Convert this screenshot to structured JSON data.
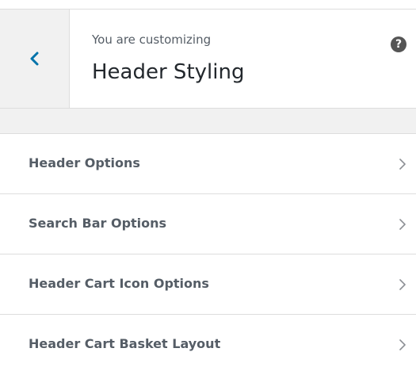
{
  "header": {
    "subtitle": "You are customizing",
    "title": "Header Styling",
    "back_icon": "chevron-left-icon",
    "help_icon": "question-circle-icon",
    "help_glyph": "?"
  },
  "sections": [
    {
      "label": "Header Options",
      "icon": "chevron-right-icon"
    },
    {
      "label": "Search Bar Options",
      "icon": "chevron-right-icon"
    },
    {
      "label": "Header Cart Icon Options",
      "icon": "chevron-right-icon"
    },
    {
      "label": "Header Cart Basket Layout",
      "icon": "chevron-right-icon"
    }
  ],
  "colors": {
    "accent": "#0073aa",
    "background_gray": "#f1f1f1",
    "border": "#dddddd",
    "text_dark": "#23282d",
    "text_muted": "#555d66"
  }
}
